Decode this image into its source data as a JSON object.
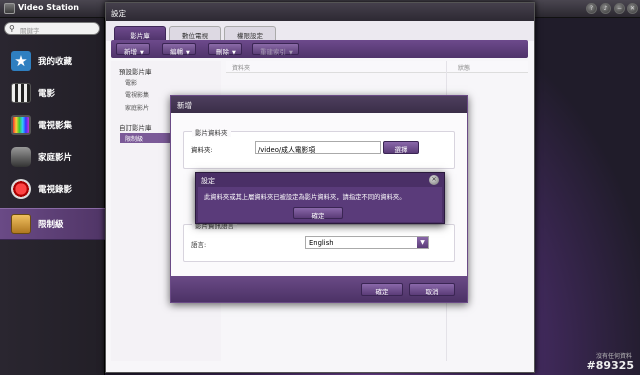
{
  "app": {
    "title": "Video Station",
    "search_placeholder": "關鍵字",
    "window_buttons": [
      "?",
      "♪",
      "−",
      "✕"
    ]
  },
  "sidebar": {
    "items": [
      {
        "label": "我的收藏",
        "icon": "star-icon",
        "color": "#3fa6e0"
      },
      {
        "label": "電影",
        "icon": "film-clapper-icon",
        "color": "#5b8bd0"
      },
      {
        "label": "電視影集",
        "icon": "tv-icon",
        "color": "#c8682e"
      },
      {
        "label": "家庭影片",
        "icon": "camcorder-icon",
        "color": "#6a6a6a"
      },
      {
        "label": "電視錄影",
        "icon": "record-icon",
        "color": "#d22b2b"
      },
      {
        "label": "限制級",
        "icon": "restricted-folder-icon",
        "color": "#c48a2a",
        "active": true
      }
    ]
  },
  "settings": {
    "title": "設定",
    "tabs": [
      "影片庫",
      "數位電視",
      "權限設定"
    ],
    "toolbar": {
      "add": "新增",
      "edit": "編輯",
      "delete": "刪除",
      "rescan": "重建索引"
    },
    "tree": {
      "default_header": "預設影片庫",
      "default_items": [
        "電影",
        "電視影集",
        "家庭影片"
      ],
      "custom_header": "自訂影片庫",
      "custom_items": [
        "限制級"
      ]
    },
    "grid_headers": {
      "folder": "資料夾",
      "status": "狀態"
    }
  },
  "add_dialog": {
    "title": "新增",
    "folder_legend": "影片資料夾",
    "folder_label": "資料夾:",
    "folder_value": "/video/成人電影項",
    "choose_button": "選擇",
    "language_legend": "影片資訊語言",
    "language_label": "語言:",
    "language_value": "English",
    "ok_button": "確定",
    "cancel_button": "取消"
  },
  "alert": {
    "title": "設定",
    "message": "此資料夾或其上層資料夾已被設定為影片資料夾，請指定不同的資料夾。",
    "ok_button": "確定"
  },
  "footer": {
    "hint": "沒有任何資料",
    "watermark": "#89325"
  }
}
